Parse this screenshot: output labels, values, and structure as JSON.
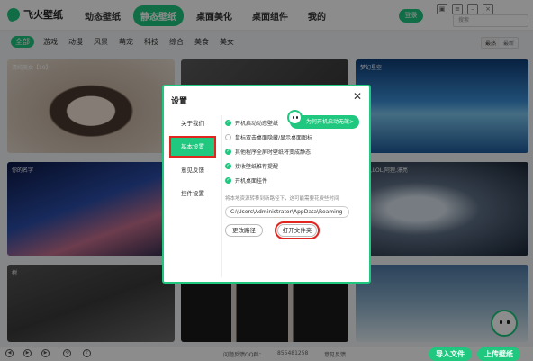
{
  "app": {
    "name": "飞火壁纸"
  },
  "nav": {
    "items": [
      "动态壁纸",
      "静态壁纸",
      "桌面美化",
      "桌面组件",
      "我的"
    ],
    "active_index": 1
  },
  "header": {
    "login": "登录",
    "search_placeholder": "搜索"
  },
  "categories": {
    "items": [
      "全部",
      "游戏",
      "动漫",
      "风景",
      "萌宠",
      "科技",
      "综合",
      "美食",
      "美女"
    ],
    "active_index": 0
  },
  "sort": {
    "options": [
      "最热",
      "最新"
    ],
    "active_index": 0
  },
  "tiles": [
    "清纯美女【19】",
    "",
    "梦幻星空",
    "你的名字",
    "",
    "美女,LOL,阿狸,漂亮",
    "树",
    "",
    ""
  ],
  "dialog": {
    "title": "设置",
    "sidebar": [
      "关于我们",
      "基本设置",
      "意见反馈",
      "控件设置"
    ],
    "sidebar_active": 1,
    "options": [
      {
        "label": "开机启动动态壁纸",
        "checked": true
      },
      {
        "label": "鼠标双击桌面隐藏/显示桌面图标",
        "checked": false
      },
      {
        "label": "其他程序全屏时壁纸将变成静态",
        "checked": true
      },
      {
        "label": "接收壁纸推荐提醒",
        "checked": true
      },
      {
        "label": "开机桌面挂件",
        "checked": true
      }
    ],
    "promo": "为何开机启动无效>",
    "tip": "将本地资源转移到新路径下，这可能需要花费些时间",
    "path_value": "C:\\Users\\Administrator\\AppData\\Roaming",
    "change_path": "更改路径",
    "open_folder": "打开文件夹"
  },
  "bottombar": {
    "qq_group": "问题反馈QQ群：",
    "qq_number": "855481258",
    "feedback": "意见反馈",
    "import": "导入文件",
    "upload": "上传壁纸"
  },
  "colors": {
    "accent": "#20c77e",
    "highlight": "#e0261e"
  }
}
